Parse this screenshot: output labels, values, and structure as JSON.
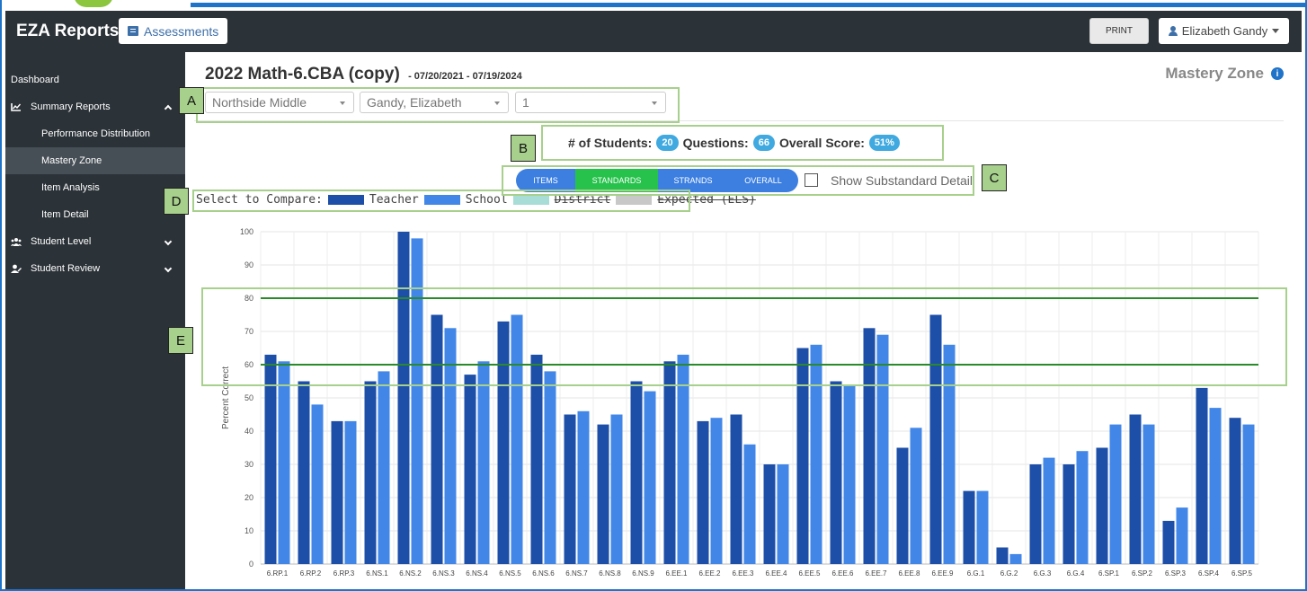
{
  "header": {
    "brand": "EZA Reports",
    "assessments_label": "Assessments",
    "print_label": "PRINT",
    "user_name": "Elizabeth Gandy"
  },
  "sidebar": {
    "dashboard": "Dashboard",
    "summary_reports": "Summary Reports",
    "performance_distribution": "Performance Distribution",
    "mastery_zone": "Mastery Zone",
    "item_analysis": "Item Analysis",
    "item_detail": "Item Detail",
    "student_level": "Student Level",
    "student_review": "Student Review"
  },
  "page": {
    "title": "2022 Math-6.CBA (copy)",
    "dates": "- 07/20/2021 - 07/19/2024",
    "report_name": "Mastery Zone",
    "info_icon": "i"
  },
  "filters": {
    "school": "Northside Middle",
    "teacher": "Gandy, Elizabeth",
    "period": "1"
  },
  "stats": {
    "students_label": "# of Students:",
    "students": "20",
    "questions_label": "Questions:",
    "questions": "66",
    "score_label": "Overall Score:",
    "score": "51%"
  },
  "view_toggle": {
    "items": "ITEMS",
    "standards": "STANDARDS",
    "strands": "STRANDS",
    "overall": "OVERALL",
    "selected": "STANDARDS"
  },
  "substandard_label": "Show Substandard Detail",
  "compare": {
    "label": "Select to Compare:",
    "teacher": "Teacher",
    "school": "School",
    "district": "District",
    "expected": "Expected (ELS)"
  },
  "callouts": {
    "a": "A",
    "b": "B",
    "c": "C",
    "d": "D",
    "e": "E"
  },
  "colors": {
    "teacher": "#1e4fa8",
    "school": "#4287e8",
    "district": "#a8dcd6",
    "expected": "#c8c8c8",
    "threshold": "#2a8a2a",
    "callout": "#a7d08c"
  },
  "chart_data": {
    "type": "bar",
    "ylabel": "Percent Correct",
    "ylim": [
      0,
      100
    ],
    "yticks": [
      0,
      10,
      20,
      30,
      40,
      50,
      60,
      70,
      80,
      90,
      100
    ],
    "grid": true,
    "threshold_lines": [
      60,
      80
    ],
    "categories": [
      "6.RP.1",
      "6.RP.2",
      "6.RP.3",
      "6.NS.1",
      "6.NS.2",
      "6.NS.3",
      "6.NS.4",
      "6.NS.5",
      "6.NS.6",
      "6.NS.7",
      "6.NS.8",
      "6.NS.9",
      "6.EE.1",
      "6.EE.2",
      "6.EE.3",
      "6.EE.4",
      "6.EE.5",
      "6.EE.6",
      "6.EE.7",
      "6.EE.8",
      "6.EE.9",
      "6.G.1",
      "6.G.2",
      "6.G.3",
      "6.G.4",
      "6.SP.1",
      "6.SP.2",
      "6.SP.3",
      "6.SP.4",
      "6.SP.5"
    ],
    "series": [
      {
        "name": "Teacher",
        "values": [
          63,
          55,
          43,
          55,
          100,
          75,
          57,
          73,
          63,
          45,
          42,
          55,
          61,
          43,
          45,
          30,
          65,
          55,
          71,
          35,
          75,
          22,
          5,
          30,
          30,
          35,
          45,
          13,
          53,
          44
        ]
      },
      {
        "name": "School",
        "values": [
          61,
          48,
          43,
          58,
          98,
          71,
          61,
          75,
          58,
          46,
          45,
          52,
          63,
          44,
          36,
          30,
          66,
          54,
          69,
          41,
          66,
          22,
          3,
          32,
          34,
          42,
          42,
          17,
          47,
          42
        ]
      }
    ]
  }
}
